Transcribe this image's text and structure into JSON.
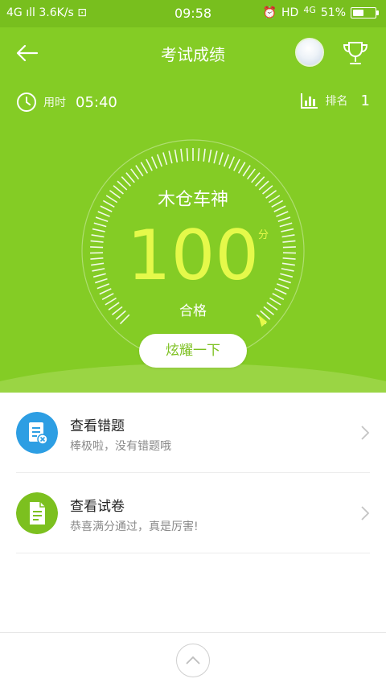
{
  "status_bar": {
    "network": "4G",
    "speed": "3.6K/s",
    "time": "09:58",
    "hd": "HD",
    "network2": "4G",
    "battery_percent": "51%",
    "battery_level": 0.51
  },
  "header": {
    "title": "考试成绩"
  },
  "stats": {
    "time_label": "用时",
    "time_value": "05:40",
    "rank_label": "排名",
    "rank_value": "1"
  },
  "gauge": {
    "title": "木仓车神",
    "score": "100",
    "unit": "分",
    "status": "合格",
    "share_label": "炫耀一下"
  },
  "list": [
    {
      "title": "查看错题",
      "subtitle": "棒极啦，没有错题哦",
      "icon": "wrong-questions-icon",
      "color": "#2d9ee3"
    },
    {
      "title": "查看试卷",
      "subtitle": "恭喜满分通过，真是厉害!",
      "icon": "exam-paper-icon",
      "color": "#7cc01f"
    }
  ],
  "colors": {
    "accent": "#84cc25",
    "score": "#e5f94a",
    "blue": "#2d9ee3"
  }
}
